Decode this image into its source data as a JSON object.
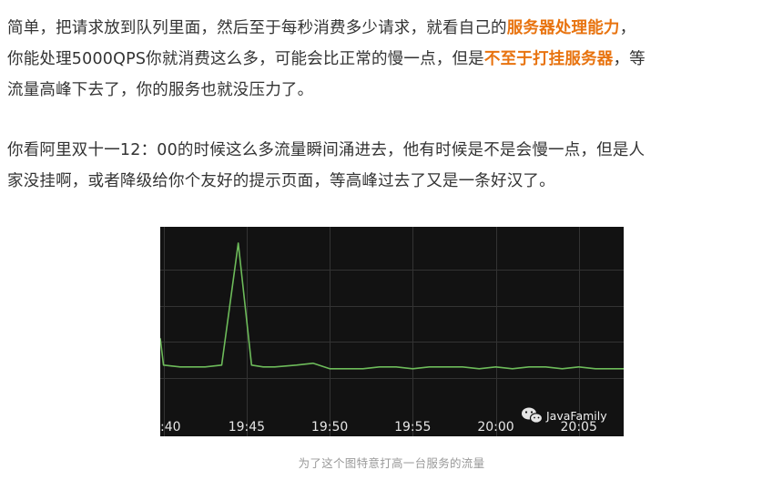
{
  "article": {
    "para1": {
      "line1": [
        "简单，把请求放到队列里面，然后至于每秒消费多少请求，就看自己的",
        "服务器处理能力",
        "，"
      ],
      "line2": [
        "你能处理5000QPS你就消费这么多，可能会比正常的慢一点，但是",
        "不至于打挂服务器",
        "，等"
      ],
      "line3": "流量高峰下去了，你的服务也就没压力了。"
    },
    "para2": {
      "line1": "你看阿里双十一12：00的时候这么多流量瞬间涌进去，他有时候是不是会慢一点，但是人",
      "line2": "家没挂啊，或者降级给你个友好的提示页面，等高峰过去了又是一条好汉了。"
    },
    "highlight_color": "#e8730f",
    "text_color": "#333333"
  },
  "figure": {
    "watermark": "JavaFamily",
    "watermark_icon": "wechat-icon",
    "background": "#121212",
    "line_color": "#6dbb5a",
    "caption": "为了这个图特意打高一台服务的流量"
  },
  "chart_data": {
    "type": "line",
    "title": "",
    "xlabel": "",
    "ylabel": "",
    "grid": true,
    "x_tick_labels": [
      ":40",
      "19:45",
      "19:50",
      "19:55",
      "20:00",
      "20:05"
    ],
    "x_ticks_minutes": [
      0,
      5,
      10,
      15,
      20,
      25
    ],
    "x_range_minutes": [
      -0.2,
      27.7
    ],
    "ylim": [
      0,
      100
    ],
    "series": [
      {
        "name": "",
        "x": [
          -0.2,
          0.0,
          1.0,
          2.5,
          3.5,
          4.5,
          5.3,
          6.0,
          6.7,
          8.0,
          9.0,
          10.0,
          11.0,
          12.0,
          13.0,
          14.0,
          15.0,
          16.0,
          17.0,
          18.0,
          19.0,
          20.0,
          21.0,
          22.0,
          23.0,
          24.0,
          25.0,
          26.0,
          27.0,
          27.7
        ],
        "y": [
          42,
          27,
          26,
          26,
          27,
          95,
          27,
          26,
          26,
          27,
          28,
          25,
          25,
          25,
          26,
          26,
          25,
          26,
          26,
          26,
          25,
          26,
          25,
          26,
          26,
          25,
          26,
          25,
          25,
          25
        ]
      }
    ]
  }
}
